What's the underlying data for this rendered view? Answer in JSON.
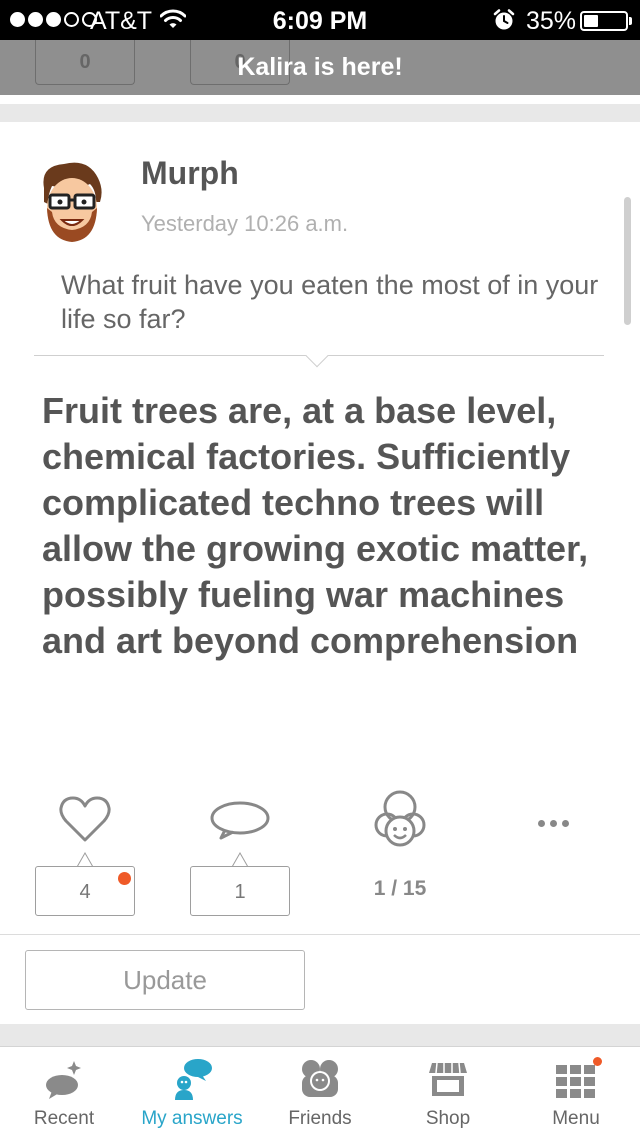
{
  "status_bar": {
    "carrier": "AT&T",
    "time": "6:09 PM",
    "battery_percent": "35%",
    "battery_level": 0.35,
    "signal_bars_filled": 3,
    "signal_bars_total": 5,
    "icons": [
      "signal-dots-icon",
      "wifi-icon",
      "alarm-icon",
      "battery-icon"
    ]
  },
  "toast": {
    "message": "Kalira is here!",
    "background_color": "#8f8f8f",
    "behind_left_count": "0",
    "behind_right_count": "0"
  },
  "post": {
    "author": "Murph",
    "timestamp": "Yesterday 10:26 a.m.",
    "question": "What fruit have you eaten the most of in your life so far?",
    "answer": "Fruit trees are, at a base level, chemical factories. Sufficiently complicated techno trees will allow the growing exotic matter, possibly fueling war machines and art beyond comprehension",
    "likes_count": "4",
    "comments_count": "1",
    "views": "1 / 15",
    "update_label": "Update",
    "icons": [
      "heart-icon",
      "comment-bubble-icon",
      "friends-face-icon",
      "more-dots-icon"
    ]
  },
  "colors": {
    "accent": "#29a5c9",
    "notification": "#ef5a28",
    "text_primary": "#555555",
    "text_muted": "#b0b0b0"
  },
  "tab_bar": {
    "active_tab": "My answers",
    "tabs": [
      {
        "label": "Recent",
        "icon": "recent-icon"
      },
      {
        "label": "My answers",
        "icon": "my-answers-icon"
      },
      {
        "label": "Friends",
        "icon": "friends-icon"
      },
      {
        "label": "Shop",
        "icon": "shop-icon"
      },
      {
        "label": "Menu",
        "icon": "menu-grid-icon"
      }
    ]
  }
}
